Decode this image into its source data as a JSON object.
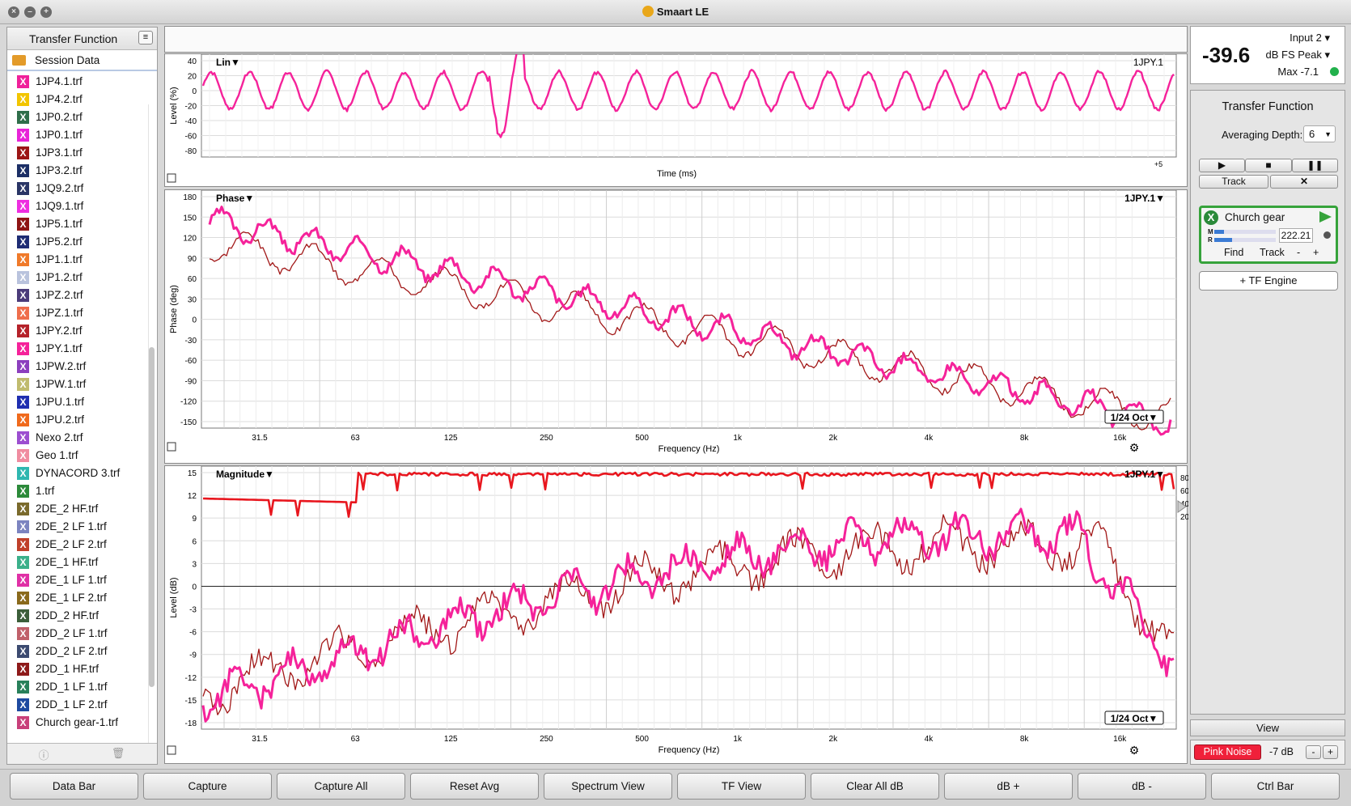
{
  "window": {
    "title": "Smaart LE"
  },
  "sidebar": {
    "title": "Transfer Function",
    "session_label": "Session Data",
    "files": [
      {
        "name": "1JP4.1.trf",
        "color": "#f0209a"
      },
      {
        "name": "1JP4.2.trf",
        "color": "#f2c500"
      },
      {
        "name": "1JP0.2.trf",
        "color": "#2f6e4a"
      },
      {
        "name": "1JP0.1.trf",
        "color": "#e824d8"
      },
      {
        "name": "1JP3.1.trf",
        "color": "#9c1616"
      },
      {
        "name": "1JP3.2.trf",
        "color": "#1c2f66"
      },
      {
        "name": "1JQ9.2.trf",
        "color": "#2a3566"
      },
      {
        "name": "1JQ9.1.trf",
        "color": "#ee2ee0"
      },
      {
        "name": "1JP5.1.trf",
        "color": "#8e1515"
      },
      {
        "name": "1JP5.2.trf",
        "color": "#1e2c74"
      },
      {
        "name": "1JP1.1.trf",
        "color": "#f07a2a"
      },
      {
        "name": "1JP1.2.trf",
        "color": "#b9c3dd"
      },
      {
        "name": "1JPZ.2.trf",
        "color": "#4b3c7a"
      },
      {
        "name": "1JPZ.1.trf",
        "color": "#ef6e4c"
      },
      {
        "name": "1JPY.2.trf",
        "color": "#b5222a"
      },
      {
        "name": "1JPY.1.trf",
        "color": "#f5229a"
      },
      {
        "name": "1JPW.2.trf",
        "color": "#8c3fbe"
      },
      {
        "name": "1JPW.1.trf",
        "color": "#c0bb6e"
      },
      {
        "name": "1JPU.1.trf",
        "color": "#1f2eb0"
      },
      {
        "name": "1JPU.2.trf",
        "color": "#f06a1c"
      },
      {
        "name": "Nexo 2.trf",
        "color": "#9c4ed0"
      },
      {
        "name": "Geo 1.trf",
        "color": "#f08ca0"
      },
      {
        "name": "DYNACORD 3.trf",
        "color": "#2fb7b0"
      },
      {
        "name": "1.trf",
        "color": "#2c8a3a"
      },
      {
        "name": "2DE_2 HF.trf",
        "color": "#7a6a2c"
      },
      {
        "name": "2DE_2 LF 1.trf",
        "color": "#7c84c0"
      },
      {
        "name": "2DE_2 LF 2.trf",
        "color": "#c0402a"
      },
      {
        "name": "2DE_1 HF.trf",
        "color": "#3bb08a"
      },
      {
        "name": "2DE_1 LF 1.trf",
        "color": "#e030a6"
      },
      {
        "name": "2DE_1 LF 2.trf",
        "color": "#8a6a1c"
      },
      {
        "name": "2DD_2 HF.trf",
        "color": "#3c5e3a"
      },
      {
        "name": "2DD_2 LF 1.trf",
        "color": "#c0606a"
      },
      {
        "name": "2DD_2 LF 2.trf",
        "color": "#3c4a70"
      },
      {
        "name": "2DD_1 HF.trf",
        "color": "#8e1a1a"
      },
      {
        "name": "2DD_1 LF 1.trf",
        "color": "#28805a"
      },
      {
        "name": "2DD_1 LF 2.trf",
        "color": "#1e4aa0"
      },
      {
        "name": "Church gear-1.trf",
        "color": "#c8407a"
      }
    ],
    "footer": {
      "info_icon": "info-icon",
      "trash_icon": "trash-icon"
    }
  },
  "impulse": {
    "mode_label": "Lin▼",
    "trace_label": "1JPY.1",
    "ylabel": "Level (%)",
    "xlabel": "Time (ms)",
    "ticks": [
      "40",
      "20",
      "0",
      "-20",
      "-40",
      "-60",
      "-80"
    ],
    "x_marker": "+5"
  },
  "phase": {
    "mode_label": "Phase▼",
    "trace_label": "1JPY.1▼",
    "ylabel": "Phase (deg)",
    "xlabel": "Frequency (Hz)",
    "yticks": [
      "180",
      "150",
      "120",
      "90",
      "60",
      "30",
      "0",
      "-30",
      "-60",
      "-90",
      "-120",
      "-150"
    ],
    "xticks": [
      "31.5",
      "63",
      "125",
      "250",
      "500",
      "1k",
      "2k",
      "4k",
      "8k",
      "16k"
    ],
    "smoothing": "1/24 Oct▼"
  },
  "magnitude": {
    "mode_label": "Magnitude▼",
    "trace_label": "1JPY.1▼",
    "ylabel": "Level (dB)",
    "xlabel": "Frequency (Hz)",
    "yticks": [
      "15",
      "12",
      "9",
      "6",
      "3",
      "0",
      "-3",
      "-6",
      "-9",
      "-12",
      "-15",
      "-18"
    ],
    "coh_ticks": [
      "80",
      "60",
      "40",
      "20"
    ],
    "xticks": [
      "31.5",
      "63",
      "125",
      "250",
      "500",
      "1k",
      "2k",
      "4k",
      "8k",
      "16k"
    ],
    "smoothing": "1/24 Oct▼"
  },
  "meter": {
    "value": "-39.6",
    "input": "Input 2",
    "unit": "dB FS Peak",
    "max": "Max -7.1",
    "status_color": "#22b14c"
  },
  "tf_panel": {
    "title": "Transfer Function",
    "avg_label": "Averaging Depth:",
    "avg_value": "6",
    "track_label": "Track",
    "engine": {
      "name": "Church gear",
      "delay": "222.21",
      "m_label": "M",
      "r_label": "R",
      "find": "Find",
      "track": "Track",
      "minus": "-",
      "plus": "+"
    },
    "add_engine": "+ TF Engine"
  },
  "view_label": "View",
  "noise": {
    "label": "Pink Noise",
    "level": "-7 dB",
    "minus": "-",
    "plus": "+"
  },
  "toolbar": [
    "Data Bar",
    "Capture",
    "Capture All",
    "Reset Avg",
    "Spectrum View",
    "TF View",
    "Clear All dB",
    "dB +",
    "dB -",
    "Ctrl Bar"
  ]
}
